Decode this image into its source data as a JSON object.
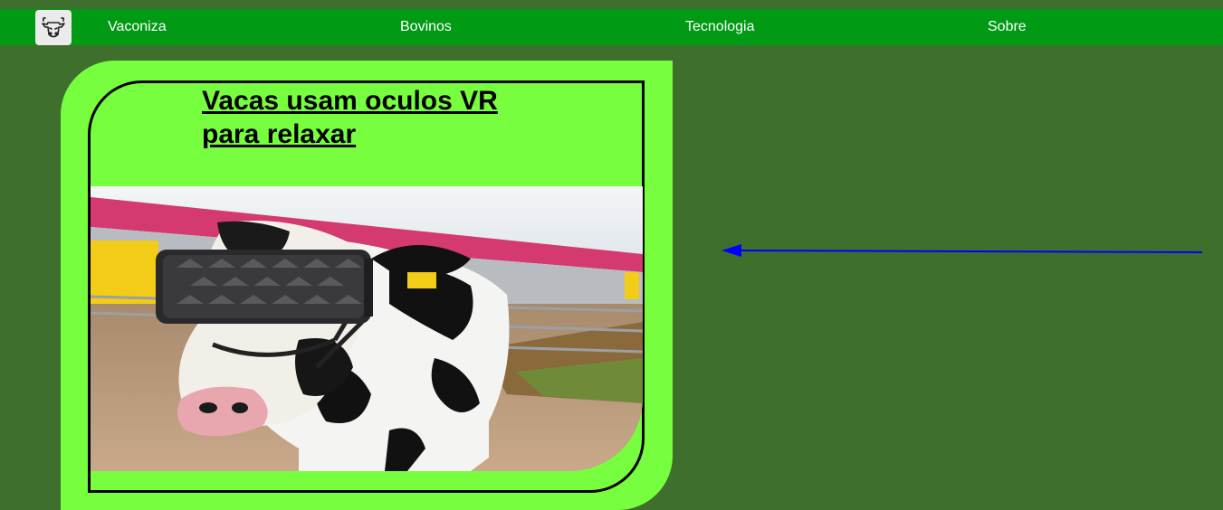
{
  "nav": {
    "logo_icon": "cow-head-icon",
    "items": [
      {
        "label": "Vaconiza"
      },
      {
        "label": "Bovinos"
      },
      {
        "label": "Tecnologia"
      },
      {
        "label": "Sobre"
      }
    ]
  },
  "article": {
    "title": "Vacas usam oculos VR para relaxar",
    "image_subject": "cow wearing VR headset"
  },
  "colors": {
    "page_background": "#3f6f2d",
    "nav_background": "#009a14",
    "card_background": "#77ff3f",
    "arrow": "#0000ff"
  }
}
